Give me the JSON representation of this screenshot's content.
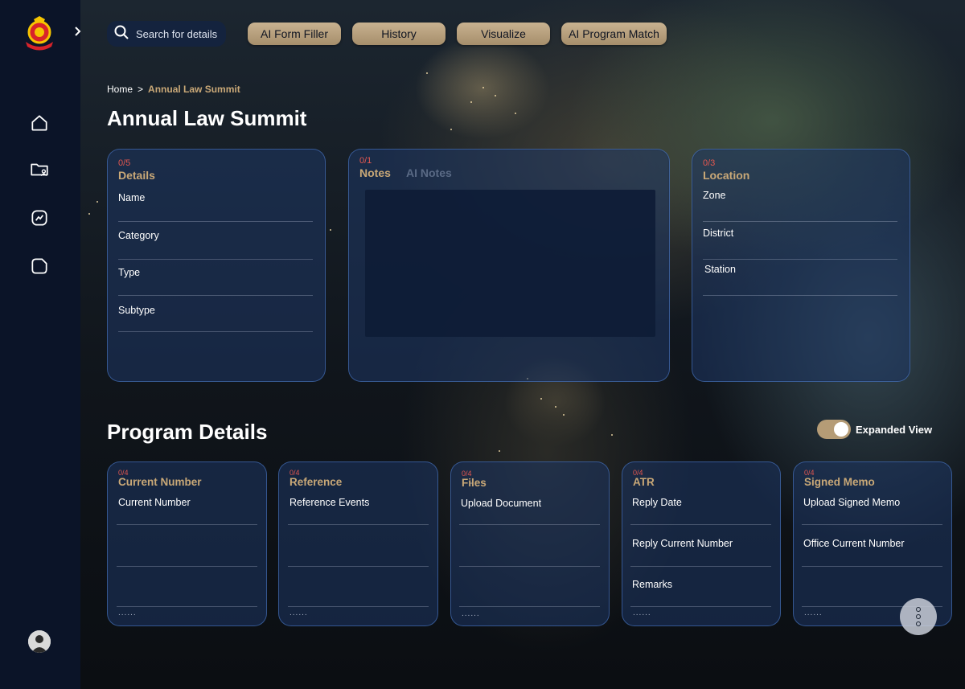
{
  "search": {
    "placeholder": "Search for details"
  },
  "toolbar": {
    "buttons": [
      "AI Form Filler",
      "History",
      "Visualize",
      "AI Program Match"
    ]
  },
  "breadcrumb": {
    "home": "Home",
    "separator": ">",
    "current": "Annual Law Summit"
  },
  "page": {
    "title": "Annual Law Summit"
  },
  "details_card": {
    "count": "0/5",
    "title": "Details",
    "fields": [
      "Name",
      "Category",
      "Type",
      "Subtype"
    ]
  },
  "notes_card": {
    "count": "0/1",
    "tabs": [
      "Notes",
      "AI Notes"
    ]
  },
  "location_card": {
    "count": "0/3",
    "title": "Location",
    "fields": [
      "Zone",
      "District",
      "Station"
    ]
  },
  "program": {
    "title": "Program Details",
    "toggle_label": "Expanded View",
    "toggle_on": true,
    "cards": [
      {
        "count": "0/4",
        "title": "Current Number",
        "fields": [
          "Current Number"
        ],
        "dots": "......"
      },
      {
        "count": "0/4",
        "title": "Reference",
        "fields": [
          "Reference Events"
        ],
        "dots": "......"
      },
      {
        "count": "0/4",
        "title": "Files",
        "fields": [
          "Upload Document"
        ],
        "dots": "......"
      },
      {
        "count": "0/4",
        "title": "ATR",
        "fields": [
          "Reply Date",
          "Reply Current Number",
          "Remarks"
        ],
        "dots": "......"
      },
      {
        "count": "0/4",
        "title": "Signed Memo",
        "fields": [
          "Upload Signed Memo",
          "Office Current Number"
        ],
        "dots": "......"
      }
    ]
  },
  "icons": [
    "logo-emblem",
    "chevron-right-icon",
    "home-icon",
    "folder-user-icon",
    "chart-icon",
    "report-icon",
    "search-icon",
    "more-vertical-icon"
  ],
  "colors": {
    "accent_gold": "#c9a877",
    "count_red": "#e4574f",
    "sidebar": "#0b1428",
    "pill": "#b59c76"
  }
}
